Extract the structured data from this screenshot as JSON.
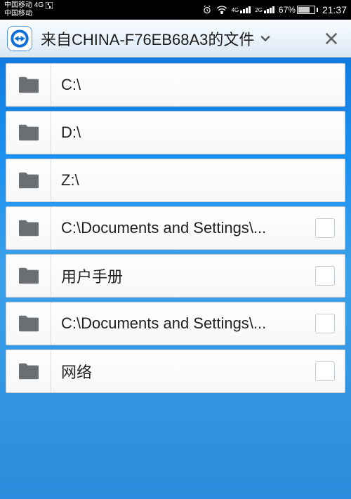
{
  "status": {
    "carrier1": "中国移动 4G",
    "carrier2": "中国移动",
    "net1": "4G",
    "net2": "2G",
    "battery": "67%",
    "time": "21:37"
  },
  "header": {
    "title": "来自CHINA-F76EB68A3的文件"
  },
  "items": [
    {
      "label": "C:\\",
      "checkbox": false
    },
    {
      "label": "D:\\",
      "checkbox": false
    },
    {
      "label": "Z:\\",
      "checkbox": false
    },
    {
      "label": "C:\\Documents and Settings\\...",
      "checkbox": true
    },
    {
      "label": "用户手册",
      "checkbox": true
    },
    {
      "label": "C:\\Documents and Settings\\...",
      "checkbox": true
    },
    {
      "label": "网络",
      "checkbox": true
    }
  ]
}
